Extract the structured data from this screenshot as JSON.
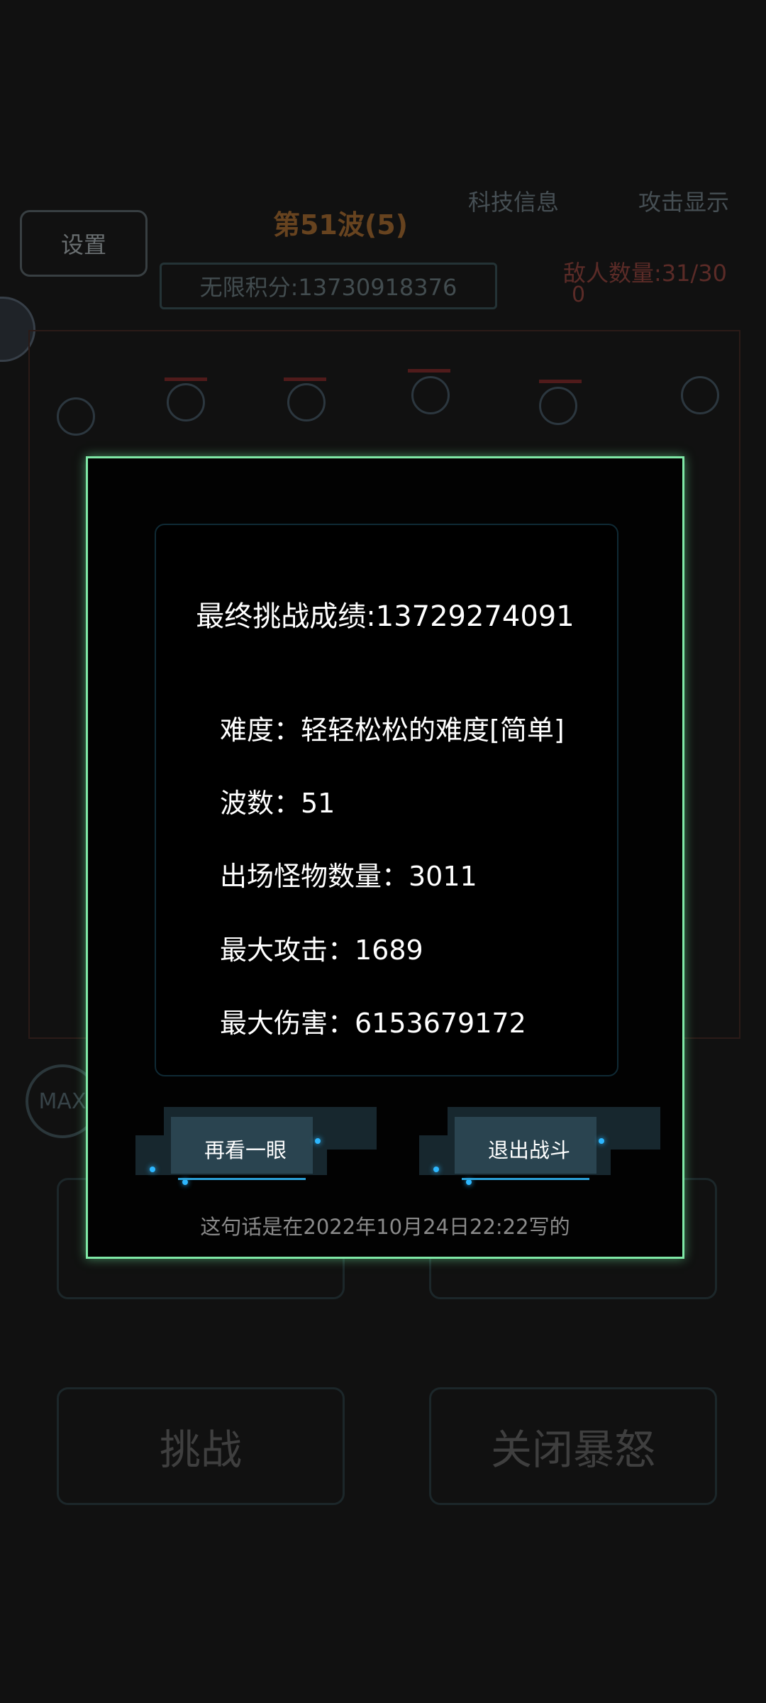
{
  "background": {
    "settings_label": "设置",
    "wave_title": "第51波(5)",
    "infinite_score": "无限积分:13730918376",
    "tech_info_label": "科技信息",
    "attack_display_label": "攻击显示",
    "enemy_count": "敌人数量:31/30",
    "enemy_sub": "0",
    "max_badge": "MAX",
    "challenge_label": "挑战",
    "close_rage_label": "关闭暴怒"
  },
  "dialog": {
    "final_score": "最终挑战成绩:13729274091",
    "difficulty": "难度：轻轻松松的难度[简单]",
    "waves": "波数：51",
    "monster_count": "出场怪物数量：3011",
    "max_attack": "最大攻击：1689",
    "max_damage": "最大伤害：6153679172",
    "review_button": "再看一眼",
    "exit_button": "退出战斗",
    "footnote": "这句话是在2022年10月24日22:22写的"
  },
  "colors": {
    "dialog_border": "#7fe8a6",
    "accent_blue": "#2db7ff",
    "background": "#171717"
  }
}
